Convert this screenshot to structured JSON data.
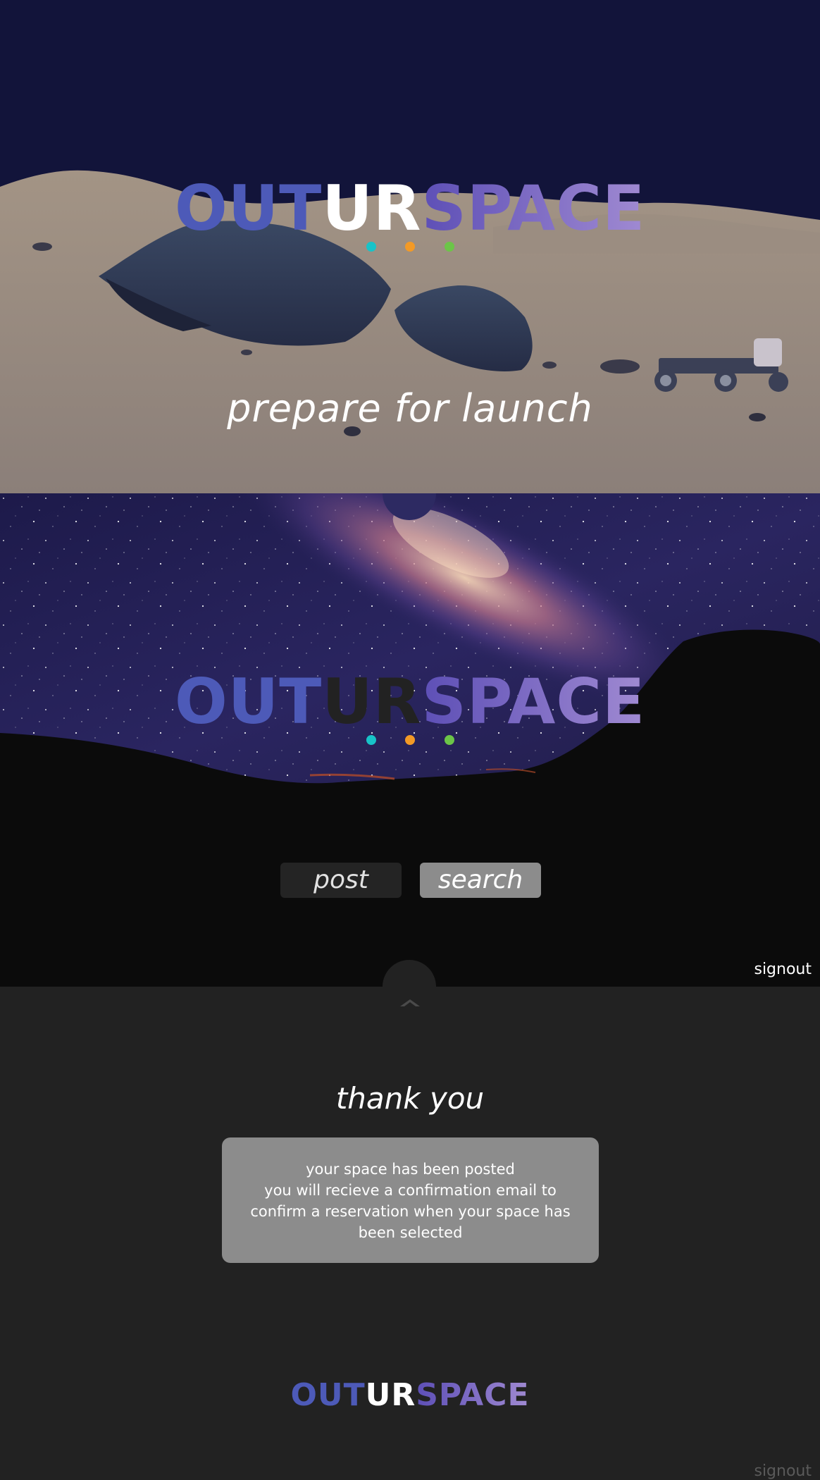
{
  "brand": {
    "logo_part1": "OUT",
    "logo_part2": "UR",
    "logo_part3": "SPACE",
    "colors": {
      "navy": "#12143a",
      "indigo": "#4d5ab8",
      "lavender": "#a08ad2",
      "dot_teal": "#18c3c8",
      "dot_orange": "#f39a26",
      "dot_green": "#6cc548"
    }
  },
  "hero": {
    "tagline": "prepare for launch"
  },
  "galaxy": {
    "post_label": "post",
    "search_label": "search",
    "signout_label": "signout"
  },
  "thanks": {
    "title": "thank you",
    "message_lines": [
      "your space has been posted",
      "you will recieve a confirmation email to",
      "confirm a reservation when your space has",
      "been selected"
    ],
    "signout_label": "signout"
  },
  "icons": {
    "collapse": "chevron-up-icon"
  }
}
